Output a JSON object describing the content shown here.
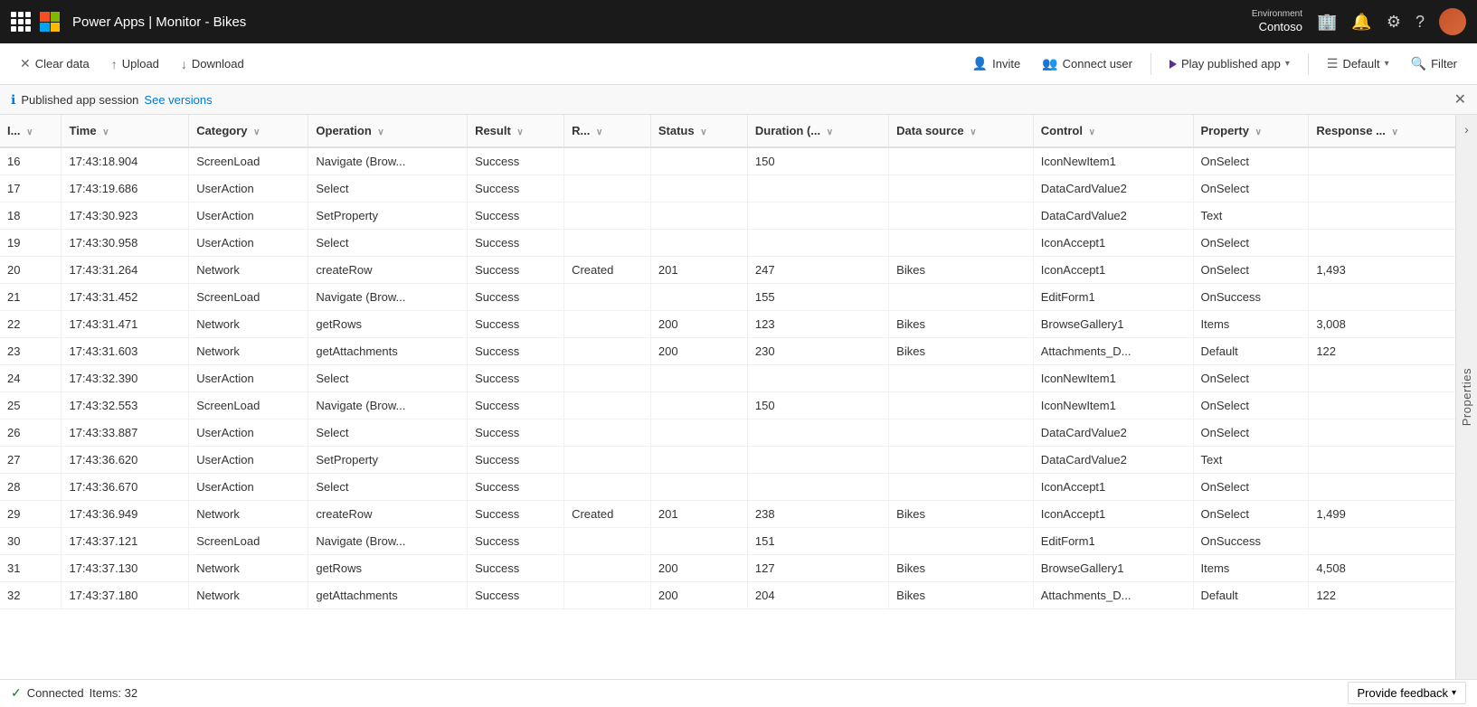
{
  "topbar": {
    "title": "Power Apps | Monitor - Bikes",
    "environment_label": "Environment",
    "environment_name": "Contoso"
  },
  "toolbar": {
    "clear_label": "Clear data",
    "upload_label": "Upload",
    "download_label": "Download",
    "invite_label": "Invite",
    "connect_user_label": "Connect user",
    "play_label": "Play published app",
    "default_label": "Default",
    "filter_label": "Filter"
  },
  "banner": {
    "info": "Published app session",
    "link": "See versions",
    "close": "✕"
  },
  "table": {
    "columns": [
      "I...",
      "Time",
      "Category",
      "Operation",
      "Result",
      "R...",
      "Status",
      "Duration (...",
      "Data source",
      "Control",
      "Property",
      "Response ..."
    ],
    "rows": [
      {
        "id": 16,
        "time": "17:43:18.904",
        "category": "ScreenLoad",
        "operation": "Navigate (Brow...",
        "result": "Success",
        "r": "",
        "status": "",
        "duration": "150",
        "datasource": "",
        "control": "IconNewItem1",
        "property": "OnSelect",
        "response": ""
      },
      {
        "id": 17,
        "time": "17:43:19.686",
        "category": "UserAction",
        "operation": "Select",
        "result": "Success",
        "r": "",
        "status": "",
        "duration": "",
        "datasource": "",
        "control": "DataCardValue2",
        "property": "OnSelect",
        "response": ""
      },
      {
        "id": 18,
        "time": "17:43:30.923",
        "category": "UserAction",
        "operation": "SetProperty",
        "result": "Success",
        "r": "",
        "status": "",
        "duration": "",
        "datasource": "",
        "control": "DataCardValue2",
        "property": "Text",
        "response": ""
      },
      {
        "id": 19,
        "time": "17:43:30.958",
        "category": "UserAction",
        "operation": "Select",
        "result": "Success",
        "r": "",
        "status": "",
        "duration": "",
        "datasource": "",
        "control": "IconAccept1",
        "property": "OnSelect",
        "response": ""
      },
      {
        "id": 20,
        "time": "17:43:31.264",
        "category": "Network",
        "operation": "createRow",
        "result": "Success",
        "r": "Created",
        "status": "201",
        "duration": "247",
        "datasource": "Bikes",
        "control": "IconAccept1",
        "property": "OnSelect",
        "response": "1,493"
      },
      {
        "id": 21,
        "time": "17:43:31.452",
        "category": "ScreenLoad",
        "operation": "Navigate (Brow...",
        "result": "Success",
        "r": "",
        "status": "",
        "duration": "155",
        "datasource": "",
        "control": "EditForm1",
        "property": "OnSuccess",
        "response": ""
      },
      {
        "id": 22,
        "time": "17:43:31.471",
        "category": "Network",
        "operation": "getRows",
        "result": "Success",
        "r": "",
        "status": "200",
        "duration": "123",
        "datasource": "Bikes",
        "control": "BrowseGallery1",
        "property": "Items",
        "response": "3,008"
      },
      {
        "id": 23,
        "time": "17:43:31.603",
        "category": "Network",
        "operation": "getAttachments",
        "result": "Success",
        "r": "",
        "status": "200",
        "duration": "230",
        "datasource": "Bikes",
        "control": "Attachments_D...",
        "property": "Default",
        "response": "122"
      },
      {
        "id": 24,
        "time": "17:43:32.390",
        "category": "UserAction",
        "operation": "Select",
        "result": "Success",
        "r": "",
        "status": "",
        "duration": "",
        "datasource": "",
        "control": "IconNewItem1",
        "property": "OnSelect",
        "response": ""
      },
      {
        "id": 25,
        "time": "17:43:32.553",
        "category": "ScreenLoad",
        "operation": "Navigate (Brow...",
        "result": "Success",
        "r": "",
        "status": "",
        "duration": "150",
        "datasource": "",
        "control": "IconNewItem1",
        "property": "OnSelect",
        "response": ""
      },
      {
        "id": 26,
        "time": "17:43:33.887",
        "category": "UserAction",
        "operation": "Select",
        "result": "Success",
        "r": "",
        "status": "",
        "duration": "",
        "datasource": "",
        "control": "DataCardValue2",
        "property": "OnSelect",
        "response": ""
      },
      {
        "id": 27,
        "time": "17:43:36.620",
        "category": "UserAction",
        "operation": "SetProperty",
        "result": "Success",
        "r": "",
        "status": "",
        "duration": "",
        "datasource": "",
        "control": "DataCardValue2",
        "property": "Text",
        "response": ""
      },
      {
        "id": 28,
        "time": "17:43:36.670",
        "category": "UserAction",
        "operation": "Select",
        "result": "Success",
        "r": "",
        "status": "",
        "duration": "",
        "datasource": "",
        "control": "IconAccept1",
        "property": "OnSelect",
        "response": ""
      },
      {
        "id": 29,
        "time": "17:43:36.949",
        "category": "Network",
        "operation": "createRow",
        "result": "Success",
        "r": "Created",
        "status": "201",
        "duration": "238",
        "datasource": "Bikes",
        "control": "IconAccept1",
        "property": "OnSelect",
        "response": "1,499"
      },
      {
        "id": 30,
        "time": "17:43:37.121",
        "category": "ScreenLoad",
        "operation": "Navigate (Brow...",
        "result": "Success",
        "r": "",
        "status": "",
        "duration": "151",
        "datasource": "",
        "control": "EditForm1",
        "property": "OnSuccess",
        "response": ""
      },
      {
        "id": 31,
        "time": "17:43:37.130",
        "category": "Network",
        "operation": "getRows",
        "result": "Success",
        "r": "",
        "status": "200",
        "duration": "127",
        "datasource": "Bikes",
        "control": "BrowseGallery1",
        "property": "Items",
        "response": "4,508"
      },
      {
        "id": 32,
        "time": "17:43:37.180",
        "category": "Network",
        "operation": "getAttachments",
        "result": "Success",
        "r": "",
        "status": "200",
        "duration": "204",
        "datasource": "Bikes",
        "control": "Attachments_D...",
        "property": "Default",
        "response": "122"
      }
    ]
  },
  "properties_panel": {
    "label": "Properties"
  },
  "status_bar": {
    "connected": "Connected",
    "items": "Items: 32",
    "feedback": "Provide feedback"
  }
}
